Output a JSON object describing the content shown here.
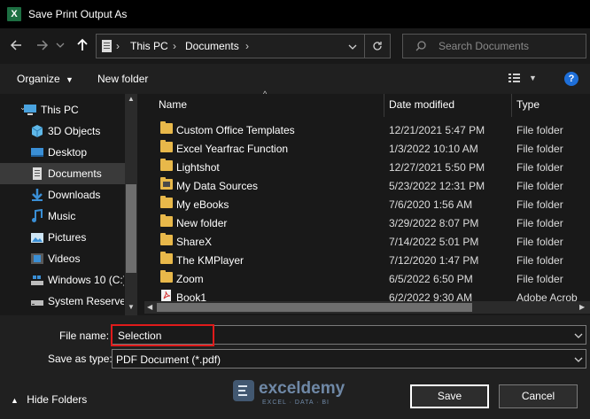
{
  "window": {
    "title": "Save Print Output As",
    "app_icon": "X"
  },
  "address": {
    "crumbs": [
      "This PC",
      "Documents"
    ]
  },
  "search": {
    "placeholder": "Search Documents"
  },
  "toolbar": {
    "organize": "Organize",
    "new_folder": "New folder"
  },
  "nav": {
    "items": [
      {
        "label": "This PC",
        "icon": "computer-icon"
      },
      {
        "label": "3D Objects",
        "icon": "cube-icon"
      },
      {
        "label": "Desktop",
        "icon": "desktop-icon"
      },
      {
        "label": "Documents",
        "icon": "documents-icon",
        "selected": true
      },
      {
        "label": "Downloads",
        "icon": "download-icon"
      },
      {
        "label": "Music",
        "icon": "music-icon"
      },
      {
        "label": "Pictures",
        "icon": "pictures-icon"
      },
      {
        "label": "Videos",
        "icon": "videos-icon"
      },
      {
        "label": "Windows 10 (C:)",
        "icon": "drive-icon"
      },
      {
        "label": "System Reserved",
        "icon": "drive-icon"
      }
    ]
  },
  "columns": {
    "name": "Name",
    "date": "Date modified",
    "type": "Type"
  },
  "files": [
    {
      "name": "Custom Office Templates",
      "date": "12/21/2021 5:47 PM",
      "type": "File folder",
      "icon": "folder-icon"
    },
    {
      "name": "Excel Yearfrac Function",
      "date": "1/3/2022 10:10 AM",
      "type": "File folder",
      "icon": "folder-icon"
    },
    {
      "name": "Lightshot",
      "date": "12/27/2021 5:50 PM",
      "type": "File folder",
      "icon": "folder-icon"
    },
    {
      "name": "My Data Sources",
      "date": "5/23/2022 12:31 PM",
      "type": "File folder",
      "icon": "data-source-folder-icon"
    },
    {
      "name": "My eBooks",
      "date": "7/6/2020 1:56 AM",
      "type": "File folder",
      "icon": "folder-icon"
    },
    {
      "name": "New folder",
      "date": "3/29/2022 8:07 PM",
      "type": "File folder",
      "icon": "folder-icon"
    },
    {
      "name": "ShareX",
      "date": "7/14/2022 5:01 PM",
      "type": "File folder",
      "icon": "folder-icon"
    },
    {
      "name": "The KMPlayer",
      "date": "7/12/2020 1:47 PM",
      "type": "File folder",
      "icon": "folder-icon"
    },
    {
      "name": "Zoom",
      "date": "6/5/2022 6:50 PM",
      "type": "File folder",
      "icon": "folder-icon"
    },
    {
      "name": "Book1",
      "date": "6/2/2022 9:30 AM",
      "type": "Adobe Acrob",
      "icon": "pdf-icon"
    }
  ],
  "form": {
    "file_name_label": "File name:",
    "file_name_value": "Selection",
    "save_type_label": "Save as type:",
    "save_type_value": "PDF Document (*.pdf)"
  },
  "footer": {
    "hide_folders": "Hide Folders",
    "save": "Save",
    "cancel": "Cancel"
  },
  "watermark": {
    "brand": "exceldemy",
    "tagline": "EXCEL · DATA · BI"
  },
  "colors": {
    "highlight": "#e01b1b",
    "folder": "#e8b84a",
    "help": "#1e6fd9",
    "excel": "#1d6f42"
  }
}
